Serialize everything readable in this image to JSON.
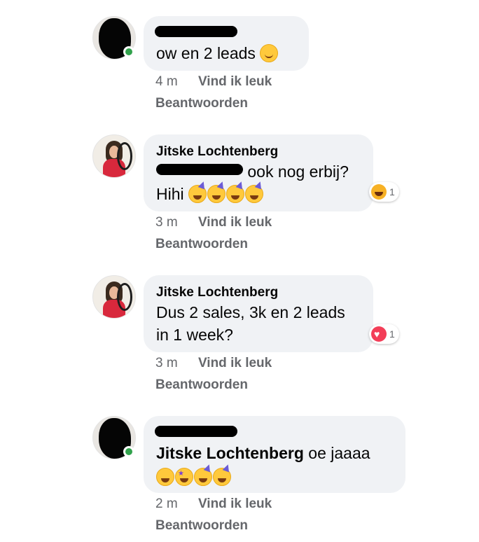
{
  "comments": [
    {
      "author": "",
      "text_line1": "ow en 2 leads",
      "time": "4 m",
      "like": "Vind ik leuk",
      "reply": "Beantwoorden"
    },
    {
      "author": "Jitske Lochtenberg",
      "text_line1_suffix": "ook nog erbij?",
      "text_line2": "Hihi",
      "time": "3 m",
      "like": "Vind ik leuk",
      "reply": "Beantwoorden",
      "reaction_count": "1"
    },
    {
      "author": "Jitske Lochtenberg",
      "text_line1": "Dus 2 sales, 3k en 2 leads",
      "text_line2": "in 1 week?",
      "time": "3 m",
      "like": "Vind ik leuk",
      "reply": "Beantwoorden",
      "reaction_count": "1"
    },
    {
      "author": "",
      "mention": "Jitske Lochtenberg",
      "text_line1_suffix": " oe jaaaa",
      "time": "2 m",
      "like": "Vind ik leuk",
      "reply": "Beantwoorden"
    }
  ],
  "icons": {
    "online": "green-dot",
    "reaction_haha": "haha-emoji",
    "reaction_love": "heart-emoji"
  },
  "colors": {
    "bubble": "#f0f2f5",
    "meta_text": "#65676b",
    "online": "#31a24c",
    "love": "#f33e58",
    "haha": "#f7b125"
  }
}
